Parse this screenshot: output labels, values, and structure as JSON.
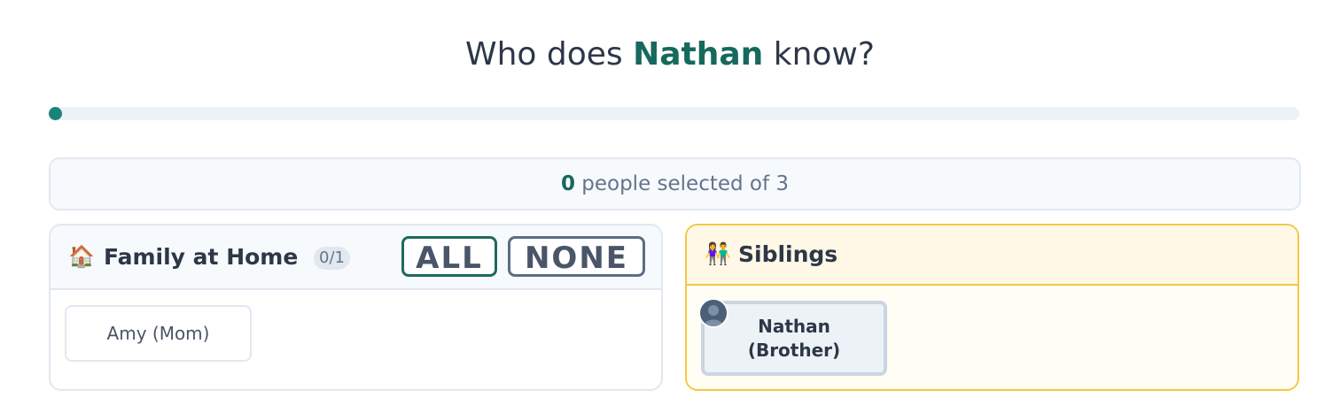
{
  "header": {
    "title_prefix": "Who does ",
    "subject_name": "Nathan",
    "title_suffix": " know?"
  },
  "progress": {
    "selected": 0,
    "total": 3,
    "fraction": 0
  },
  "counter": {
    "count": "0",
    "text": " people selected of 3"
  },
  "groups": [
    {
      "icon": "house-icon",
      "icon_glyph": "🏠",
      "title": "Family at Home",
      "badge": "0/1",
      "buttons": {
        "all": "ALL",
        "none": "NONE"
      },
      "people": [
        {
          "label": "Amy (Mom)"
        }
      ]
    },
    {
      "icon": "siblings-icon",
      "icon_glyph": "👫",
      "title": "Siblings",
      "people": [
        {
          "line1": "Nathan",
          "line2": "(Brother)",
          "avatar": "person-avatar-icon"
        }
      ]
    }
  ],
  "colors": {
    "accent": "#16695c",
    "siblings_border": "#f6c744"
  }
}
